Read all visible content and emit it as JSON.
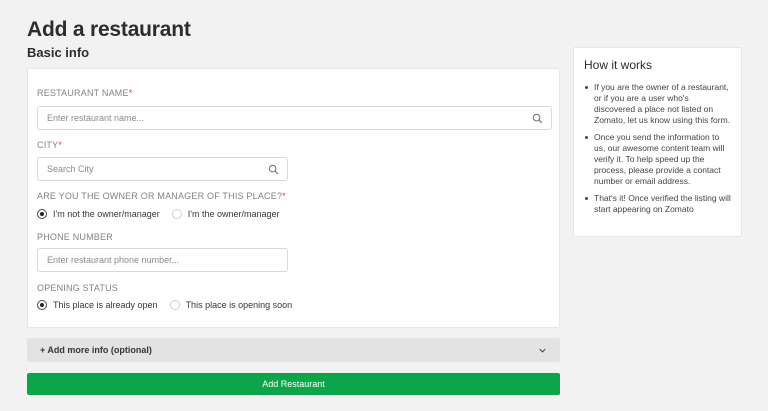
{
  "page": {
    "title": "Add a restaurant",
    "section": "Basic info"
  },
  "form": {
    "name_label": "RESTAURANT NAME",
    "name_placeholder": "Enter restaurant name...",
    "city_label": "CITY",
    "city_placeholder": "Search City",
    "owner_label": "ARE YOU THE OWNER OR MANAGER OF THIS PLACE?",
    "owner_options": [
      {
        "label": "I'm not the owner/manager",
        "checked": true
      },
      {
        "label": "I'm the owner/manager",
        "checked": false
      }
    ],
    "phone_label": "PHONE NUMBER",
    "phone_placeholder": "Enter restaurant phone number...",
    "status_label": "OPENING STATUS",
    "status_options": [
      {
        "label": "This place is already open",
        "checked": true
      },
      {
        "label": "This place is opening soon",
        "checked": false
      }
    ],
    "required_mark": "*"
  },
  "more_info": {
    "label": "+ Add more info (optional)"
  },
  "submit": {
    "label": "Add Restaurant"
  },
  "side": {
    "title": "How it works",
    "items": [
      "If you are the owner of a restaurant, or if you are a user who's discovered a place not listed on Zomato, let us know using this form.",
      "Once you send the information to us, our awesome content team will verify it. To help speed up the process, please provide a contact number or email address.",
      "That's it! Once verified the listing will start appearing on Zomato"
    ]
  },
  "colors": {
    "accent_green": "#0ca54a",
    "required_red": "#e23744",
    "background": "#f2f2f2"
  },
  "icons": [
    "search-icon",
    "chevron-down-icon",
    "radio-icon"
  ]
}
